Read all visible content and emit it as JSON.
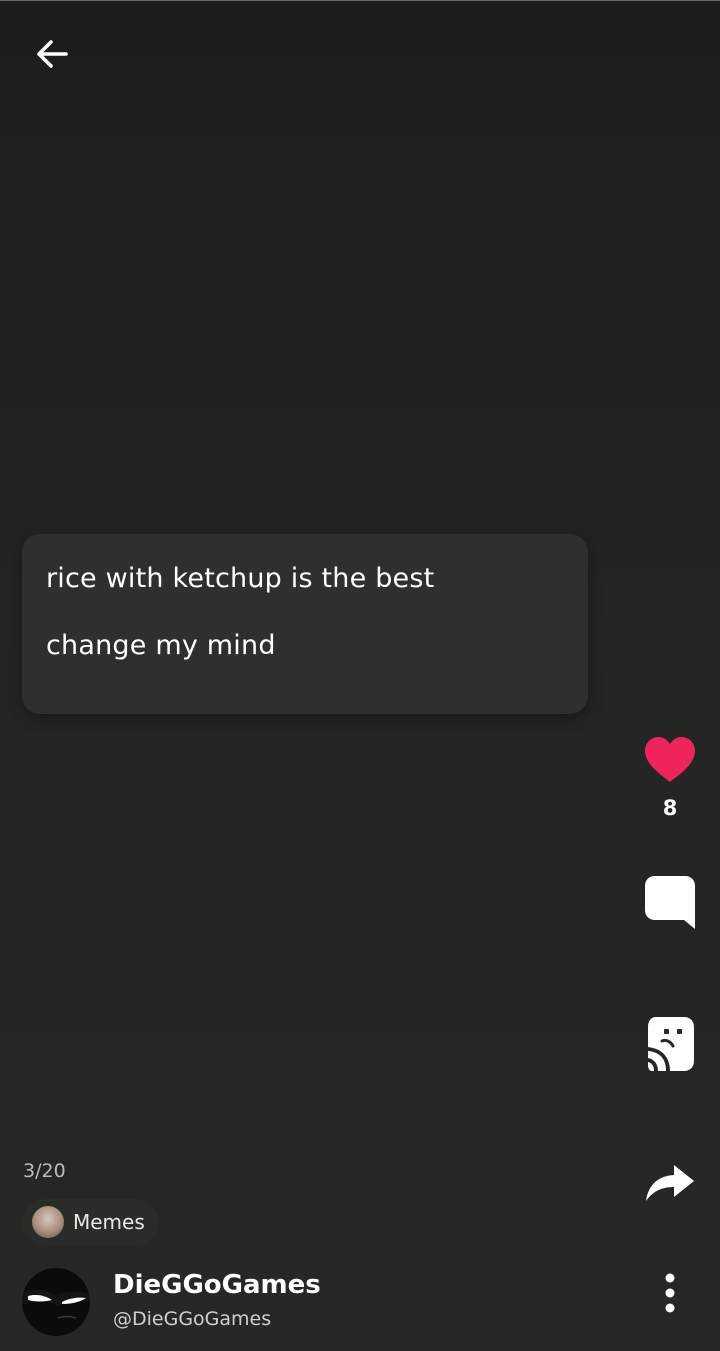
{
  "header": {
    "back_icon": "arrow-left-icon"
  },
  "post": {
    "lines": [
      "rice with ketchup is the best",
      "change my mind"
    ],
    "page_counter": "3/20"
  },
  "actions": {
    "like_icon": "heart-icon",
    "like_count": "8",
    "like_color": "#f0245d",
    "comment_icon": "comment-bubble-icon",
    "sticker_icon": "sticker-icon",
    "share_icon": "share-arrow-icon",
    "more_icon": "more-vertical-icon"
  },
  "community": {
    "name": "Memes"
  },
  "author": {
    "name": "DieGGoGames",
    "handle": "@DieGGoGames"
  }
}
